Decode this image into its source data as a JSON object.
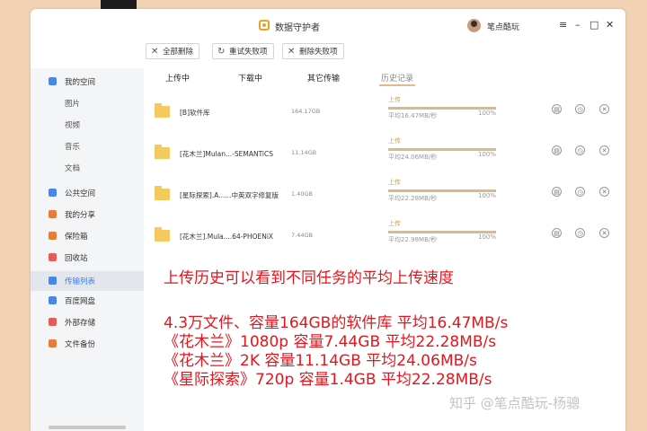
{
  "app": {
    "title": "数据守护者",
    "user": "笔点酷玩"
  },
  "window_controls": {
    "menu": "≡",
    "minimize": "–",
    "maximize": "□",
    "close": "✕"
  },
  "toolbar": {
    "delete_all": "全部删除",
    "retry_failed": "重试失败项",
    "delete_failed": "删除失败项"
  },
  "sidebar": {
    "items": [
      {
        "label": "我的空间",
        "icon": "cloud-space-icon",
        "color": "#4a86e8"
      },
      {
        "label": "图片",
        "sub": true
      },
      {
        "label": "视频",
        "sub": true
      },
      {
        "label": "音乐",
        "sub": true
      },
      {
        "label": "文档",
        "sub": true
      },
      {
        "label": "公共空间",
        "icon": "share-space-icon",
        "color": "#4a86e8"
      },
      {
        "label": "我的分享",
        "icon": "my-share-icon",
        "color": "#e67e3a"
      },
      {
        "label": "保险箱",
        "icon": "safe-icon",
        "color": "#e67e3a"
      },
      {
        "label": "回收站",
        "icon": "trash-icon",
        "color": "#e65a5a"
      },
      {
        "label": "传输列表",
        "icon": "transfer-icon",
        "color": "#4a86e8",
        "active": true
      },
      {
        "label": "百度网盘",
        "icon": "baidu-disk-icon",
        "color": "#4a86e8"
      },
      {
        "label": "外部存储",
        "icon": "external-storage-icon",
        "color": "#e65a5a"
      },
      {
        "label": "文件备份",
        "icon": "backup-icon",
        "color": "#e67e3a"
      }
    ]
  },
  "tabs": [
    "上传中",
    "下载中",
    "其它传输",
    "历史记录"
  ],
  "active_tab": "历史记录",
  "transfers": [
    {
      "name": "[B]软件库",
      "size": "164.17GB",
      "status": "上传",
      "speed": "平均16.47MB/秒",
      "percent": "100%",
      "progress": 1.0
    },
    {
      "name": "[花木兰]Mulan...-SEMANTiCS",
      "size": "11.14GB",
      "status": "上传",
      "speed": "平均24.06MB/秒",
      "percent": "100%",
      "progress": 1.0
    },
    {
      "name": "[星际探索].A......中英双字修复版",
      "size": "1.40GB",
      "status": "上传",
      "speed": "平均22.28MB/秒",
      "percent": "100%",
      "progress": 1.0
    },
    {
      "name": "[花木兰].Mula....64-PHOENiX",
      "size": "7.44GB",
      "status": "上传",
      "speed": "平均22.98MB/秒",
      "percent": "100%",
      "progress": 1.0
    }
  ],
  "overlay": {
    "headline": "上传历史可以看到不同任务的平均上传速度",
    "lines": [
      "4.3万文件、容量164GB的软件库 平均16.47MB/s",
      "《花木兰》1080p 容量7.44GB 平均22.28MB/s",
      "《花木兰》2K 容量11.14GB      平均24.06MB/s",
      "《星际探索》720p 容量1.4GB  平均22.28MB/s"
    ]
  },
  "watermark": "知乎 @笔点酷玩-杨骢",
  "colors": {
    "accent": "#3f7ef2",
    "overlay_text": "#e6151d",
    "progress": "#d9b987"
  }
}
